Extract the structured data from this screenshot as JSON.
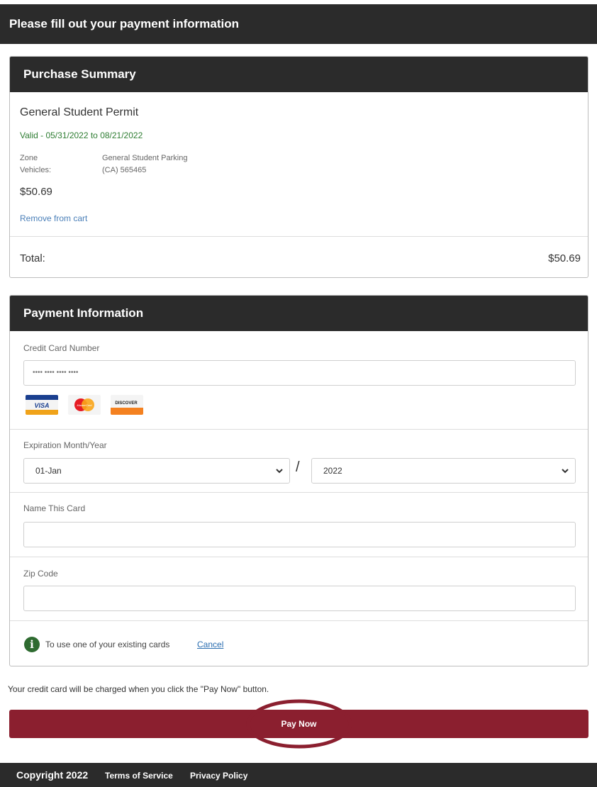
{
  "header": {
    "title": "Please fill out your payment information"
  },
  "summary": {
    "title": "Purchase Summary",
    "permit_name": "General Student Permit",
    "valid": "Valid - 05/31/2022 to 08/21/2022",
    "zone_label": "Zone",
    "zone_value": "General Student Parking",
    "vehicles_label": "Vehicles:",
    "vehicles_value": "(CA) 565465",
    "price": "$50.69",
    "remove_link": "Remove from cart",
    "total_label": "Total:",
    "total_value": "$50.69"
  },
  "payment": {
    "title": "Payment Information",
    "cc_label": "Credit Card Number",
    "cc_placeholder": "•••• •••• •••• ••••",
    "card_logos": [
      "VISA",
      "MasterCard",
      "DISCOVER"
    ],
    "exp_label": "Expiration Month/Year",
    "exp_month": "01-Jan",
    "exp_separator": "/",
    "exp_year": "2022",
    "name_label": "Name This Card",
    "zip_label": "Zip Code",
    "existing_text": "To use one of your existing cards",
    "cancel_link": "Cancel"
  },
  "charge_note": "Your credit card will be charged when you click the \"Pay Now\" button.",
  "pay_button": "Pay Now",
  "footer": {
    "copyright": "Copyright 2022",
    "terms": "Terms of Service",
    "privacy": "Privacy Policy"
  },
  "colors": {
    "header_bg": "#2b2b2b",
    "pay_button": "#8b1f2f",
    "valid_text": "#2e7d32",
    "link": "#2a6db0"
  },
  "icons": {
    "info": "info-circle-icon",
    "chevron": "chevron-down-icon"
  }
}
